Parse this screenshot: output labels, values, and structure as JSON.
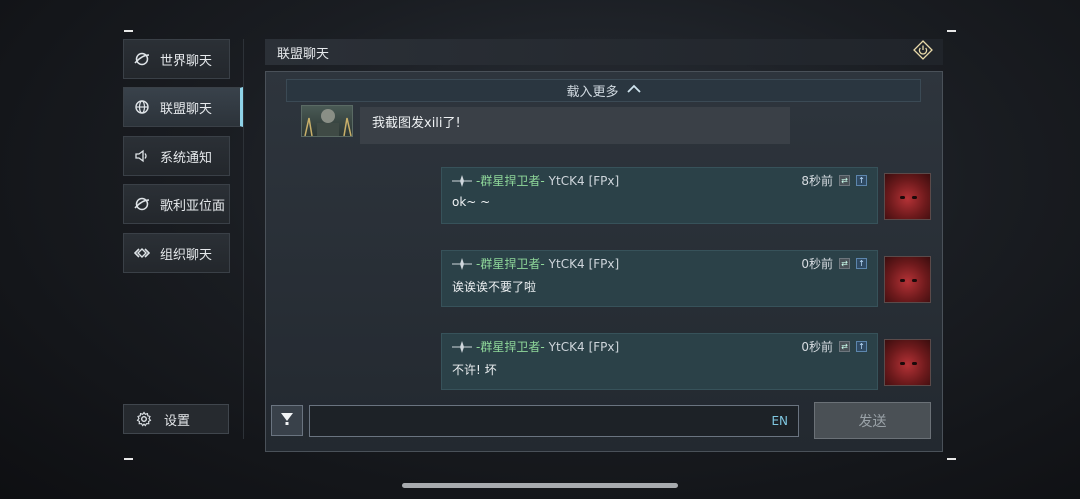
{
  "sidebar": {
    "items": [
      {
        "label": "世界聊天",
        "icon": "globe-swirl-icon"
      },
      {
        "label": "联盟聊天",
        "icon": "globe-icon",
        "active": true
      },
      {
        "label": "系统通知",
        "icon": "speaker-icon"
      },
      {
        "label": "歌利亚位面",
        "icon": "globe-swirl-icon"
      },
      {
        "label": "组织聊天",
        "icon": "chain-icon"
      }
    ],
    "settings_label": "设置"
  },
  "header": {
    "title": "联盟聊天",
    "exit_icon": "power-icon"
  },
  "chat": {
    "load_more": "载入更多",
    "top_message": {
      "text": "我截图发xili了!"
    },
    "messages": [
      {
        "name": "-群星捍卫者-",
        "user": "YtCK4",
        "tag": "[FPx]",
        "time": "8秒前",
        "text": "ok~ ~"
      },
      {
        "name": "-群星捍卫者-",
        "user": "YtCK4",
        "tag": "[FPx]",
        "time": "0秒前",
        "text": "诶诶诶不要了啦"
      },
      {
        "name": "-群星捍卫者-",
        "user": "YtCK4",
        "tag": "[FPx]",
        "time": "0秒前",
        "text": "不许! 坏"
      }
    ]
  },
  "input": {
    "lang": "EN",
    "placeholder": "",
    "send_label": "发送"
  },
  "colors": {
    "accent": "#8fd3e8",
    "name_green": "#8fd89a",
    "bubble": "#2b4148"
  }
}
